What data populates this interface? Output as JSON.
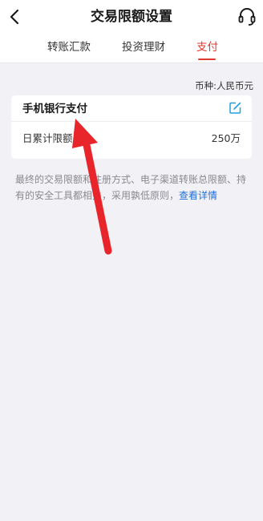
{
  "header": {
    "title": "交易限额设置",
    "back_icon": "chevron-left-icon",
    "service_icon": "headset-icon"
  },
  "tabs": [
    {
      "label": "转账汇款",
      "active": false
    },
    {
      "label": "投资理财",
      "active": false
    },
    {
      "label": "支付",
      "active": true
    }
  ],
  "currency_label": "币种:人民币元",
  "card": {
    "title": "手机银行支付",
    "edit_icon": "edit-icon",
    "rows": [
      {
        "label": "日累计限额",
        "value": "250万"
      }
    ]
  },
  "notice": {
    "text": "最终的交易限额和注册方式、电子渠道转账总限额、持有的安全工具都相关，采用孰低原则，",
    "link_text": "查看详情"
  },
  "annotation": {
    "type": "red-arrow",
    "color": "#e8252a"
  },
  "colors": {
    "accent": "#e03a2f",
    "link": "#1f6fd6",
    "background": "#f2f1f6",
    "edit_icon": "#1f9fe0"
  }
}
